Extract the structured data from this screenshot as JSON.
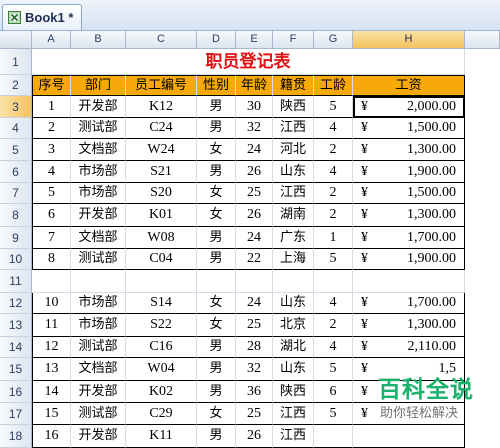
{
  "tab": {
    "title": "Book1 *"
  },
  "columns": [
    "A",
    "B",
    "C",
    "D",
    "E",
    "F",
    "G",
    "H"
  ],
  "rows": [
    "1",
    "2",
    "3",
    "4",
    "5",
    "6",
    "7",
    "8",
    "9",
    "10",
    "11",
    "12",
    "13",
    "14",
    "15",
    "16",
    "17",
    "18"
  ],
  "sheet": {
    "title": "职员登记表",
    "headers": [
      "序号",
      "部门",
      "员工编号",
      "性别",
      "年龄",
      "籍贯",
      "工龄",
      "工资"
    ],
    "records": [
      {
        "seq": "1",
        "dept": "开发部",
        "id": "K12",
        "sex": "男",
        "age": "30",
        "place": "陕西",
        "years": "5",
        "cur": "¥",
        "salary": "2,000.00"
      },
      {
        "seq": "2",
        "dept": "测试部",
        "id": "C24",
        "sex": "男",
        "age": "32",
        "place": "江西",
        "years": "4",
        "cur": "¥",
        "salary": "1,500.00"
      },
      {
        "seq": "3",
        "dept": "文档部",
        "id": "W24",
        "sex": "女",
        "age": "24",
        "place": "河北",
        "years": "2",
        "cur": "¥",
        "salary": "1,300.00"
      },
      {
        "seq": "4",
        "dept": "市场部",
        "id": "S21",
        "sex": "男",
        "age": "26",
        "place": "山东",
        "years": "4",
        "cur": "¥",
        "salary": "1,900.00"
      },
      {
        "seq": "5",
        "dept": "市场部",
        "id": "S20",
        "sex": "女",
        "age": "25",
        "place": "江西",
        "years": "2",
        "cur": "¥",
        "salary": "1,500.00"
      },
      {
        "seq": "6",
        "dept": "开发部",
        "id": "K01",
        "sex": "女",
        "age": "26",
        "place": "湖南",
        "years": "2",
        "cur": "¥",
        "salary": "1,300.00"
      },
      {
        "seq": "7",
        "dept": "文档部",
        "id": "W08",
        "sex": "男",
        "age": "24",
        "place": "广东",
        "years": "1",
        "cur": "¥",
        "salary": "1,700.00"
      },
      {
        "seq": "8",
        "dept": "测试部",
        "id": "C04",
        "sex": "男",
        "age": "22",
        "place": "上海",
        "years": "5",
        "cur": "¥",
        "salary": "1,900.00"
      },
      {
        "seq": "",
        "dept": "",
        "id": "",
        "sex": "",
        "age": "",
        "place": "",
        "years": "",
        "cur": "",
        "salary": ""
      },
      {
        "seq": "10",
        "dept": "市场部",
        "id": "S14",
        "sex": "女",
        "age": "24",
        "place": "山东",
        "years": "4",
        "cur": "¥",
        "salary": "1,700.00"
      },
      {
        "seq": "11",
        "dept": "市场部",
        "id": "S22",
        "sex": "女",
        "age": "25",
        "place": "北京",
        "years": "2",
        "cur": "¥",
        "salary": "1,300.00"
      },
      {
        "seq": "12",
        "dept": "测试部",
        "id": "C16",
        "sex": "男",
        "age": "28",
        "place": "湖北",
        "years": "4",
        "cur": "¥",
        "salary": "2,110.00"
      },
      {
        "seq": "13",
        "dept": "文档部",
        "id": "W04",
        "sex": "男",
        "age": "32",
        "place": "山东",
        "years": "5",
        "cur": "¥",
        "salary": "1,5"
      },
      {
        "seq": "14",
        "dept": "开发部",
        "id": "K02",
        "sex": "男",
        "age": "36",
        "place": "陕西",
        "years": "6",
        "cur": "¥",
        "salary": ""
      },
      {
        "seq": "15",
        "dept": "测试部",
        "id": "C29",
        "sex": "女",
        "age": "25",
        "place": "江西",
        "years": "5",
        "cur": "¥",
        "salary": ""
      },
      {
        "seq": "16",
        "dept": "开发部",
        "id": "K11",
        "sex": "男",
        "age": "26",
        "place": "江西",
        "years": "",
        "cur": "",
        "salary": ""
      }
    ]
  },
  "selected_cell": "H3",
  "watermark": {
    "brand": "百科全说",
    "sub": "助你轻松解决"
  }
}
